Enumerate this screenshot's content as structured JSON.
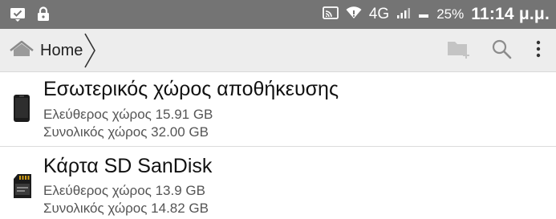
{
  "status_bar": {
    "network": "4G",
    "battery": "25%",
    "clock": "11:14 μ.μ.",
    "icons": [
      "check-notification-icon",
      "lock-icon",
      "cast-icon",
      "wifi-icon",
      "signal-icon",
      "battery-icon"
    ]
  },
  "toolbar": {
    "breadcrumb_home": "Home",
    "actions": [
      "new-folder-icon",
      "search-icon",
      "more-vert-icon"
    ]
  },
  "storage": [
    {
      "title": "Εσωτερικός χώρος αποθήκευσης",
      "free": "Ελεύθερος χώρος 15.91 GB",
      "total": "Συνολικός χώρος 32.00 GB",
      "icon": "phone-icon"
    },
    {
      "title": "Κάρτα SD SanDisk",
      "free": "Ελεύθερος χώρος 13.9 GB",
      "total": "Συνολικός χώρος 14.82 GB",
      "icon": "sd-card-icon"
    }
  ],
  "colors": {
    "status_bar_bg": "#747474",
    "toolbar_bg": "#ededed",
    "divider": "#dcdcdc"
  }
}
